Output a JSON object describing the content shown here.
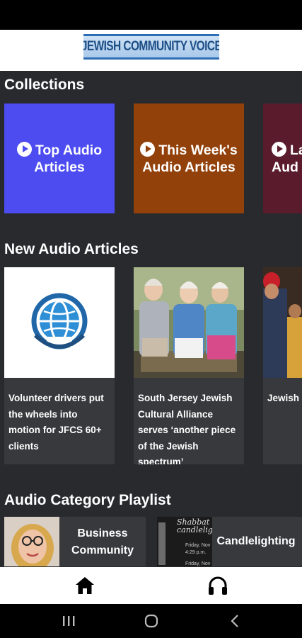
{
  "app": {
    "logo_text": "JEWISH COMMUNITY VOICE"
  },
  "collections": {
    "title": "Collections",
    "items": [
      {
        "label": "Top Audio Articles",
        "line1": "Top Audio",
        "line2": "Articles",
        "color": "#4c4cf0"
      },
      {
        "label": "This Week's Audio Articles",
        "line1": "This Week's",
        "line2": "Audio Articles",
        "color": "#93410a"
      },
      {
        "label": "La... Aud...",
        "line1": "La",
        "line2": "Aud",
        "color": "#5a1c2c"
      }
    ]
  },
  "new_articles": {
    "title": "New Audio Articles",
    "items": [
      {
        "title": "Volunteer drivers put the wheels into motion for JFCS 60+ clients",
        "image": "globe-logo"
      },
      {
        "title": "South Jersey Jewish Cultural Alliance serves ‘another piece of the Jewish spectrum’",
        "image": "photo-three-women"
      },
      {
        "title": "Jewish conden element shootin some p",
        "image": "photo-crowd"
      }
    ]
  },
  "playlists": {
    "title": "Audio Category Playlist",
    "items": [
      {
        "label": "Business Community",
        "line1": "Business",
        "line2": "Community",
        "image": "portrait-woman"
      },
      {
        "label": "Candlelighting",
        "line1": "Candlelighting",
        "image": "candlelighting-flyer",
        "thumb_text": [
          "Shabbat",
          "candlelight",
          "Friday, Nov",
          "4:29 p.m.",
          "Friday, Nov"
        ]
      }
    ]
  },
  "bottom_nav": {
    "items": [
      {
        "name": "home",
        "icon": "home-icon",
        "active": true
      },
      {
        "name": "audio",
        "icon": "headphones-icon",
        "active": false
      }
    ]
  },
  "system_nav": {
    "items": [
      "recent-apps-icon",
      "home-circle-icon",
      "back-chevron-icon"
    ]
  }
}
